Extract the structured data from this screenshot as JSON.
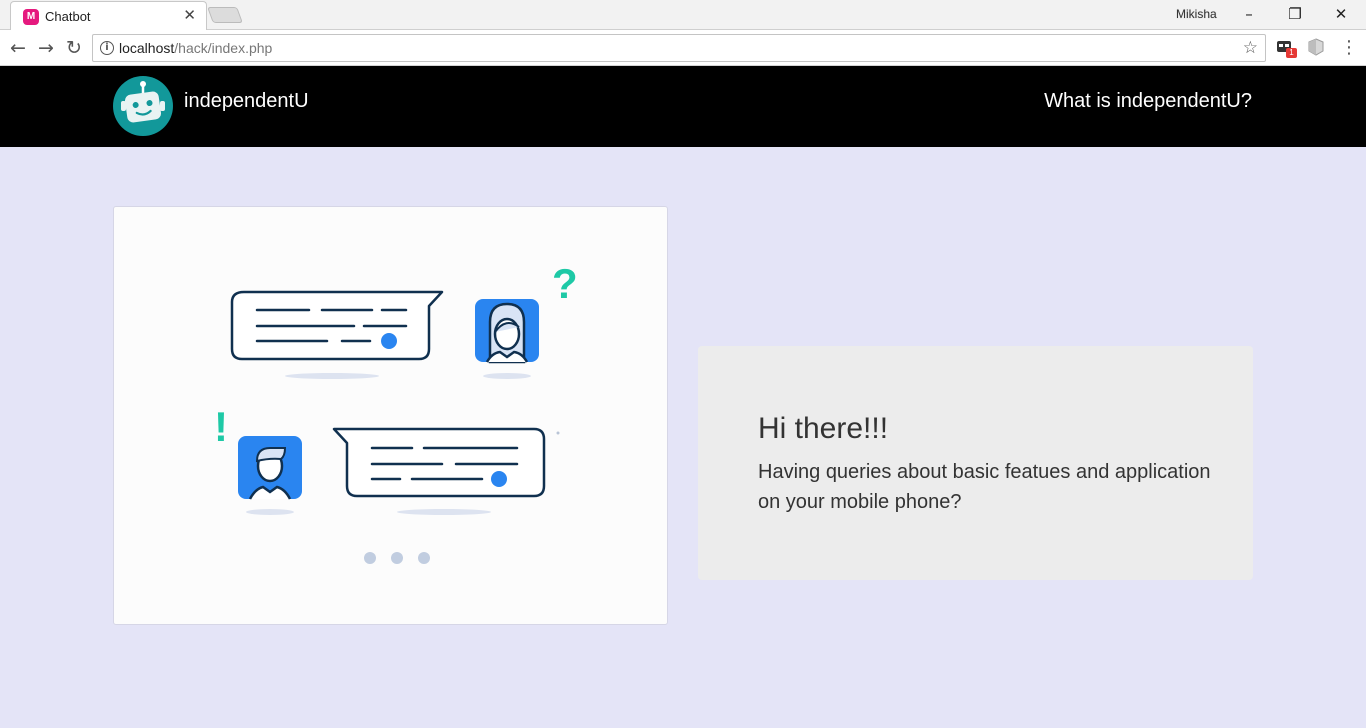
{
  "browser": {
    "tab_title": "Chatbot",
    "url_host": "localhost",
    "url_path": "/hack/index.php",
    "profile_name": "Mikisha",
    "extension_badge": "1"
  },
  "header": {
    "brand": "independentU",
    "nav_link": "What is independentU?"
  },
  "greeting": {
    "title": "Hi there!!!",
    "text": "Having queries about basic featues and application on your mobile phone?"
  },
  "illustration": {
    "question_mark": "?",
    "exclamation_mark": "!"
  },
  "colors": {
    "header_bg": "#000000",
    "page_bg": "#e4e4f7",
    "accent_blue": "#2a85f0",
    "accent_teal": "#1ec9a6",
    "logo_teal": "#12989a",
    "navy_stroke": "#10304f"
  }
}
